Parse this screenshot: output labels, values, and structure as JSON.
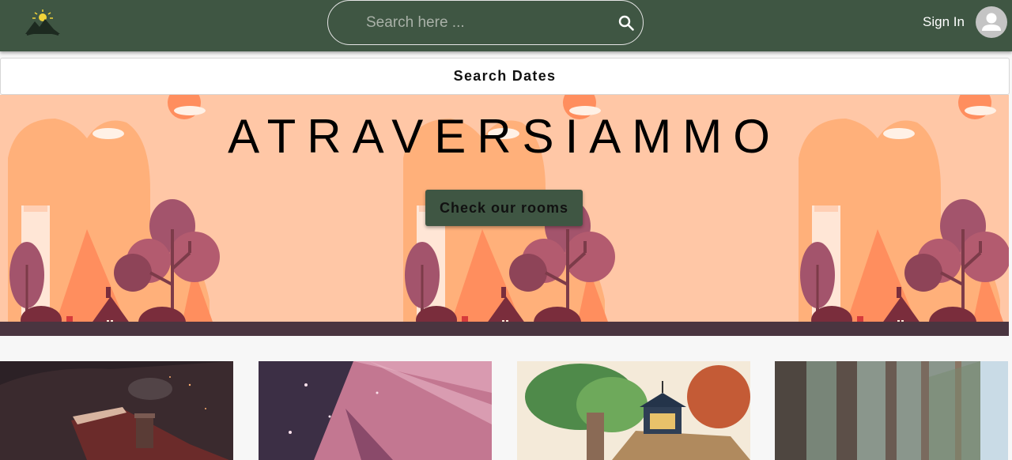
{
  "header": {
    "logo": "mountain-sun-logo",
    "search": {
      "placeholder": "Search here ...",
      "icon": "search-icon"
    },
    "sign_in": "Sign In",
    "avatar_icon": "user-avatar-icon"
  },
  "search_dates": {
    "label": "Search Dates"
  },
  "hero": {
    "title": "ATRAVERSIAMMO",
    "cta_label": "Check our rooms"
  },
  "cards": [
    {
      "image": "cabin-at-night-illustration"
    },
    {
      "image": "purple-mountain-illustration"
    },
    {
      "image": "watercolor-cottage-painting"
    },
    {
      "image": "pine-forest-photo"
    }
  ],
  "colors": {
    "primary": "#3f5643",
    "hero_background": "#ffc7a6",
    "page_background": "#f7f7f7"
  }
}
